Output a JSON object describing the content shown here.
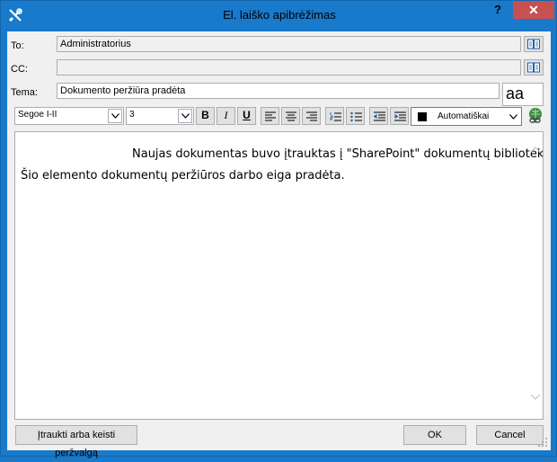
{
  "window": {
    "title": "El. laiško apibrėžimas",
    "help_label": "?",
    "close_label": "✕"
  },
  "fields": {
    "to_label": "To:",
    "to_value": "Administratorius",
    "cc_label": "CC:",
    "cc_value": "",
    "subject_label": "Tema:",
    "subject_value": "Dokumento peržiūra pradėta"
  },
  "toolbar": {
    "font_name": "Segoe I-II",
    "font_size": "3",
    "bold": "B",
    "italic": "I",
    "underline": "U",
    "color_label": "Automatiškai",
    "color_swatch": "#000000",
    "preview_text": "aa"
  },
  "editor": {
    "line1": "Naujas dokumentas buvo įtrauktas į \"SharePoint\" dokumentų biblioteką in",
    "line2": "Šio elemento dokumentų peržiūros darbo eiga pradėta."
  },
  "buttons": {
    "lookup": "Įtraukti arba keisti peržvalgą",
    "ok": "OK",
    "cancel": "Cancel"
  },
  "colors": {
    "frame": "#1979ca",
    "close": "#c75050",
    "client": "#f0f0f0"
  }
}
